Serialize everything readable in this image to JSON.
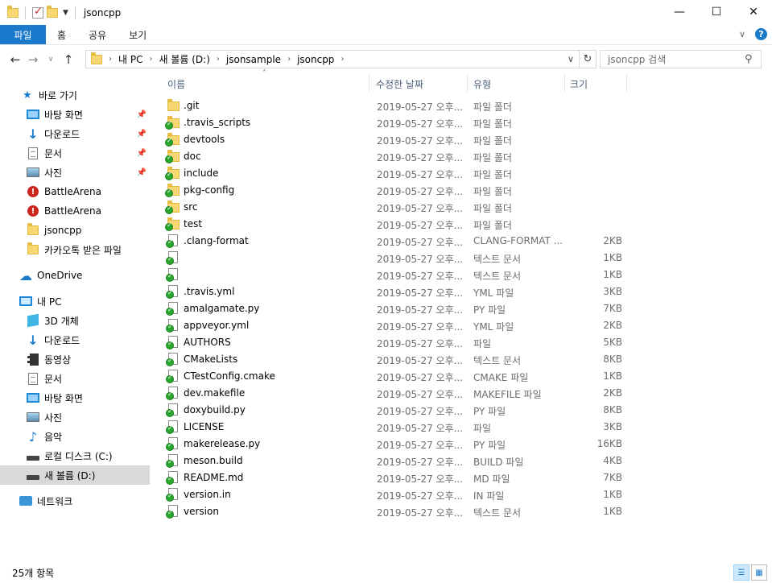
{
  "window": {
    "title": "jsoncpp",
    "controls": [
      "minimize",
      "maximize",
      "close"
    ]
  },
  "ribbon": {
    "tabs": [
      "파일",
      "홈",
      "공유",
      "보기"
    ]
  },
  "address": {
    "crumbs": [
      "내 PC",
      "새 볼륨 (D:)",
      "jsonsample",
      "jsoncpp"
    ]
  },
  "search": {
    "placeholder": "jsoncpp 검색"
  },
  "sidebar": {
    "items": [
      {
        "label": "바로 가기",
        "icon": "star-icon"
      },
      {
        "label": "바탕 화면",
        "icon": "desktop-icon",
        "pinned": true
      },
      {
        "label": "다운로드",
        "icon": "download-icon",
        "pinned": true
      },
      {
        "label": "문서",
        "icon": "document-icon",
        "pinned": true
      },
      {
        "label": "사진",
        "icon": "picture-icon",
        "pinned": true
      },
      {
        "label": "BattleArena",
        "icon": "warning-folder-icon"
      },
      {
        "label": "BattleArena",
        "icon": "warning-folder-icon"
      },
      {
        "label": "jsoncpp",
        "icon": "folder-icon"
      },
      {
        "label": "카카오톡 받은 파일",
        "icon": "folder-icon"
      },
      {
        "label": "OneDrive",
        "icon": "cloud-icon"
      },
      {
        "label": "내 PC",
        "icon": "pc-icon"
      },
      {
        "label": "3D 개체",
        "icon": "3d-objects-icon"
      },
      {
        "label": "다운로드",
        "icon": "download-icon"
      },
      {
        "label": "동영상",
        "icon": "video-icon"
      },
      {
        "label": "문서",
        "icon": "document-icon"
      },
      {
        "label": "바탕 화면",
        "icon": "desktop-icon"
      },
      {
        "label": "사진",
        "icon": "picture-icon"
      },
      {
        "label": "음악",
        "icon": "music-icon"
      },
      {
        "label": "로컬 디스크 (C:)",
        "icon": "drive-icon"
      },
      {
        "label": "새 볼륨 (D:)",
        "icon": "drive-icon",
        "selected": true
      },
      {
        "label": "네트워크",
        "icon": "network-icon"
      }
    ]
  },
  "columns": {
    "name": "이름",
    "date": "수정한 날짜",
    "type": "유형",
    "size": "크기"
  },
  "files": [
    {
      "name": ".git",
      "date": "2019-05-27 오후...",
      "type": "파일 폴더",
      "size": "",
      "kind": "folder",
      "synced": false
    },
    {
      "name": ".travis_scripts",
      "date": "2019-05-27 오후...",
      "type": "파일 폴더",
      "size": "",
      "kind": "folder",
      "synced": true
    },
    {
      "name": "devtools",
      "date": "2019-05-27 오후...",
      "type": "파일 폴더",
      "size": "",
      "kind": "folder",
      "synced": true
    },
    {
      "name": "doc",
      "date": "2019-05-27 오후...",
      "type": "파일 폴더",
      "size": "",
      "kind": "folder",
      "synced": true
    },
    {
      "name": "include",
      "date": "2019-05-27 오후...",
      "type": "파일 폴더",
      "size": "",
      "kind": "folder",
      "synced": true
    },
    {
      "name": "pkg-config",
      "date": "2019-05-27 오후...",
      "type": "파일 폴더",
      "size": "",
      "kind": "folder",
      "synced": true
    },
    {
      "name": "src",
      "date": "2019-05-27 오후...",
      "type": "파일 폴더",
      "size": "",
      "kind": "folder",
      "synced": true
    },
    {
      "name": "test",
      "date": "2019-05-27 오후...",
      "type": "파일 폴더",
      "size": "",
      "kind": "folder",
      "synced": true
    },
    {
      "name": ".clang-format",
      "date": "2019-05-27 오후...",
      "type": "CLANG-FORMAT ...",
      "size": "2KB",
      "kind": "file",
      "synced": true
    },
    {
      "name": "",
      "date": "2019-05-27 오후...",
      "type": "텍스트 문서",
      "size": "1KB",
      "kind": "file",
      "synced": true
    },
    {
      "name": "",
      "date": "2019-05-27 오후...",
      "type": "텍스트 문서",
      "size": "1KB",
      "kind": "file",
      "synced": true
    },
    {
      "name": ".travis.yml",
      "date": "2019-05-27 오후...",
      "type": "YML 파일",
      "size": "3KB",
      "kind": "file",
      "synced": true
    },
    {
      "name": "amalgamate.py",
      "date": "2019-05-27 오후...",
      "type": "PY 파일",
      "size": "7KB",
      "kind": "file",
      "synced": true
    },
    {
      "name": "appveyor.yml",
      "date": "2019-05-27 오후...",
      "type": "YML 파일",
      "size": "2KB",
      "kind": "file",
      "synced": true
    },
    {
      "name": "AUTHORS",
      "date": "2019-05-27 오후...",
      "type": "파일",
      "size": "5KB",
      "kind": "file",
      "synced": true
    },
    {
      "name": "CMakeLists",
      "date": "2019-05-27 오후...",
      "type": "텍스트 문서",
      "size": "8KB",
      "kind": "file",
      "synced": true
    },
    {
      "name": "CTestConfig.cmake",
      "date": "2019-05-27 오후...",
      "type": "CMAKE 파일",
      "size": "1KB",
      "kind": "file",
      "synced": true
    },
    {
      "name": "dev.makefile",
      "date": "2019-05-27 오후...",
      "type": "MAKEFILE 파일",
      "size": "2KB",
      "kind": "file",
      "synced": true
    },
    {
      "name": "doxybuild.py",
      "date": "2019-05-27 오후...",
      "type": "PY 파일",
      "size": "8KB",
      "kind": "file",
      "synced": true
    },
    {
      "name": "LICENSE",
      "date": "2019-05-27 오후...",
      "type": "파일",
      "size": "3KB",
      "kind": "file",
      "synced": true
    },
    {
      "name": "makerelease.py",
      "date": "2019-05-27 오후...",
      "type": "PY 파일",
      "size": "16KB",
      "kind": "file",
      "synced": true
    },
    {
      "name": "meson.build",
      "date": "2019-05-27 오후...",
      "type": "BUILD 파일",
      "size": "4KB",
      "kind": "file",
      "synced": true
    },
    {
      "name": "README.md",
      "date": "2019-05-27 오후...",
      "type": "MD 파일",
      "size": "7KB",
      "kind": "file",
      "synced": true
    },
    {
      "name": "version.in",
      "date": "2019-05-27 오후...",
      "type": "IN 파일",
      "size": "1KB",
      "kind": "file",
      "synced": true
    },
    {
      "name": "version",
      "date": "2019-05-27 오후...",
      "type": "텍스트 문서",
      "size": "1KB",
      "kind": "file",
      "synced": true
    }
  ],
  "status": {
    "count": "25개 항목"
  }
}
